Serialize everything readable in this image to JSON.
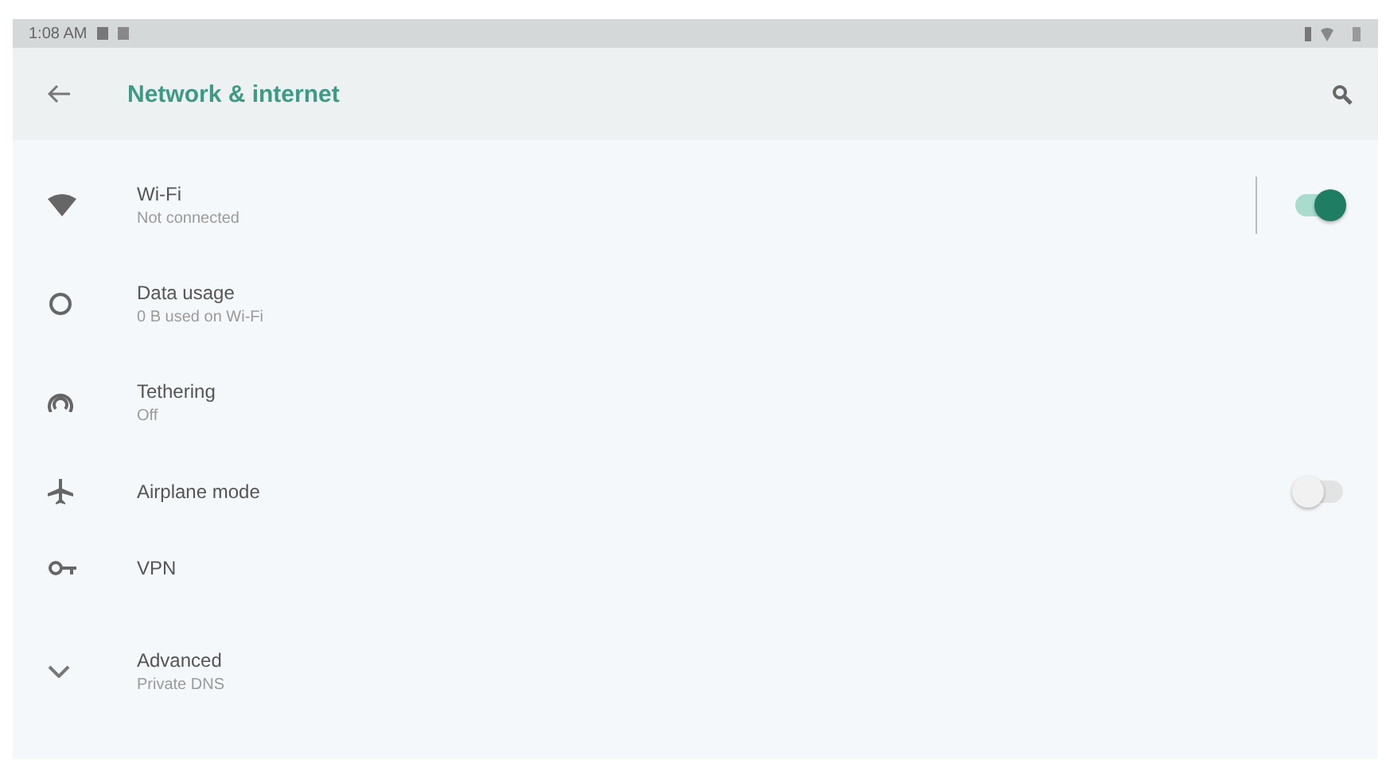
{
  "status_bar": {
    "time": "1:08 AM"
  },
  "app_bar": {
    "title": "Network & internet"
  },
  "items": [
    {
      "kind": "wifi",
      "title": "Wi-Fi",
      "summary": "Not connected",
      "on": true
    },
    {
      "kind": "data",
      "title": "Data usage",
      "summary": "0 B used on Wi-Fi"
    },
    {
      "kind": "tethering",
      "title": "Tethering",
      "summary": "Off"
    },
    {
      "kind": "airplane",
      "title": "Airplane mode",
      "on": false
    },
    {
      "kind": "vpn",
      "title": "VPN"
    },
    {
      "kind": "advanced",
      "title": "Advanced",
      "summary": "Private DNS"
    }
  ]
}
